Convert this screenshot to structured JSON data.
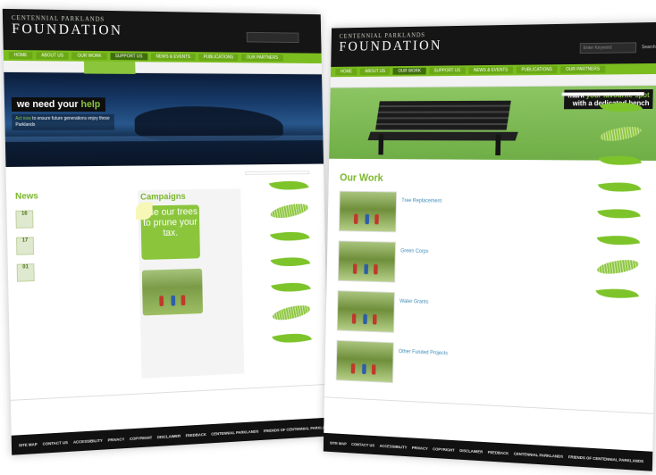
{
  "left_page": {
    "brand": {
      "sub": "CENTENNIAL PARKLANDS",
      "main": "FOUNDATION"
    },
    "search": {
      "placeholder": "",
      "button": ""
    },
    "nav": [
      "HOME",
      "ABOUT US",
      "OUR WORK",
      "SUPPORT US",
      "NEWS & EVENTS",
      "PUBLICATIONS",
      "OUR PARTNERS"
    ],
    "dropdown": [
      "",
      "",
      "",
      "",
      ""
    ],
    "breadcrumb": "",
    "hero": {
      "title_white": "we need your ",
      "title_green": "help",
      "sub_green": "Act now",
      "sub_white": " to ensure future generations enjoy these Parklands"
    },
    "intro": "",
    "news": {
      "title": "News",
      "items": [
        {
          "month": "",
          "day": "16",
          "title": "",
          "text": ""
        },
        {
          "month": "",
          "day": "17",
          "title": "",
          "text": ""
        },
        {
          "month": "",
          "day": "01",
          "title": "",
          "text": ""
        }
      ]
    },
    "campaigns": {
      "title": "Campaigns",
      "box_text": "Use our trees to prune your tax.",
      "caption_link": "",
      "caption_text": "",
      "caption2": ""
    },
    "gardens_tab": "",
    "footer_text": "",
    "footer_links": [
      "SITE MAP",
      "CONTACT US",
      "ACCESSIBILITY",
      "PRIVACY",
      "COPYRIGHT",
      "DISCLAIMER",
      "FEEDBACK",
      "CENTENNIAL PARKLANDS",
      "FRIENDS OF CENTENNIAL PARKLANDS"
    ]
  },
  "right_page": {
    "brand": {
      "sub": "CENTENNIAL PARKLANDS",
      "main": "FOUNDATION"
    },
    "search": {
      "placeholder": "Enter Keyword",
      "button": "Search"
    },
    "nav": [
      "HOME",
      "ABOUT US",
      "OUR WORK",
      "SUPPORT US",
      "NEWS & EVENTS",
      "PUBLICATIONS",
      "OUR PARTNERS"
    ],
    "breadcrumb": "",
    "hero": {
      "line1_white": "mark ",
      "line1_green": "your favourite spot",
      "line2": "with a dedicated bench"
    },
    "share": "",
    "gardens_title": "",
    "our_work": {
      "title": "Our Work",
      "items": [
        {
          "title": "Tree Replacement",
          "text": ""
        },
        {
          "title": "Green Corps",
          "text": ""
        },
        {
          "title": "Water Grants",
          "text": ""
        },
        {
          "title": "Other Funded Projects",
          "text": ""
        }
      ]
    },
    "leaf_labels": [
      "",
      "",
      "",
      "",
      "",
      "",
      "",
      ""
    ],
    "footer_text": "",
    "footer_links": [
      "SITE MAP",
      "CONTACT US",
      "ACCESSIBILITY",
      "PRIVACY",
      "COPYRIGHT",
      "DISCLAIMER",
      "FEEDBACK",
      "CENTENNIAL PARKLANDS",
      "FRIENDS OF CENTENNIAL PARKLANDS"
    ]
  },
  "colors": {
    "accent": "#8cc63f",
    "nav": "#7bbd1f",
    "header": "#151515",
    "link": "#3f8cb8"
  }
}
